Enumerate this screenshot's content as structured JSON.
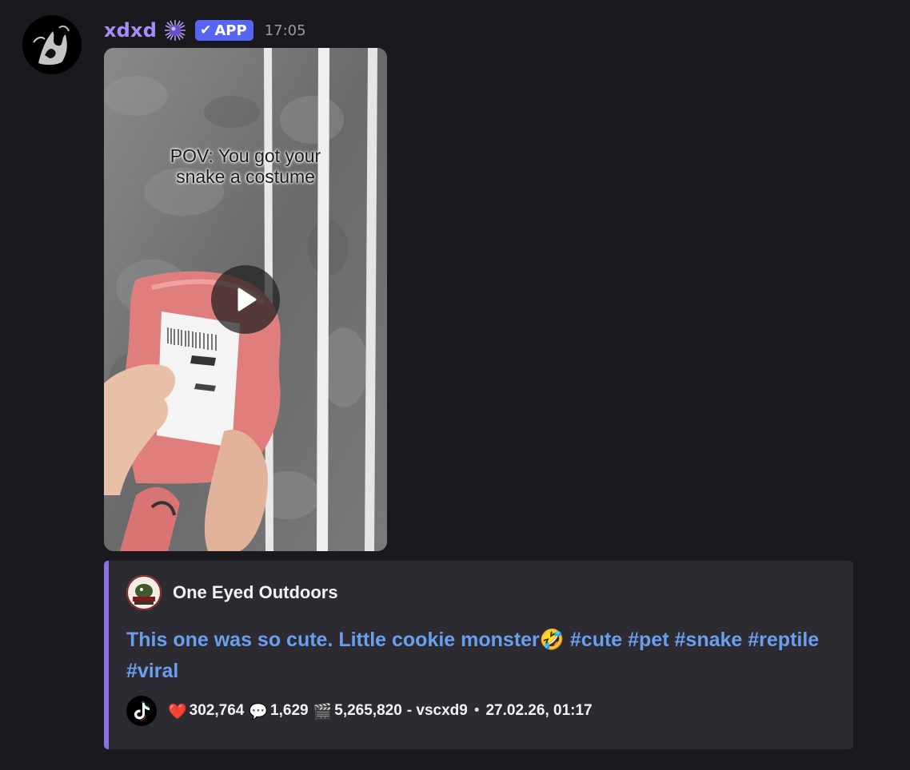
{
  "message": {
    "author": {
      "username": "xdxd",
      "role_icon": "spiky-purple-orb-icon",
      "badge": "APP",
      "timestamp": "17:05"
    },
    "video": {
      "caption_line1": "POV: You got your",
      "caption_line2": "snake a costume",
      "play_icon": "play-icon"
    },
    "embed": {
      "accent_color": "#8c6fe0",
      "author_name": "One Eyed Outdoors",
      "description_text": "This one was so cute. Little cookie monster",
      "description_emoji": "🤣",
      "hashtags": [
        "#cute",
        "#pet",
        "#snake",
        "#reptile",
        "#viral"
      ],
      "footer": {
        "icon": "tiktok-icon",
        "likes_icon": "❤️",
        "likes": "302,764",
        "comments_icon": "💬",
        "comments": "1,629",
        "views_icon": "🎬",
        "views": "5,265,820",
        "uploader": "- vscxd9",
        "separator": "•",
        "date": "27.02.26, 01:17"
      }
    }
  }
}
